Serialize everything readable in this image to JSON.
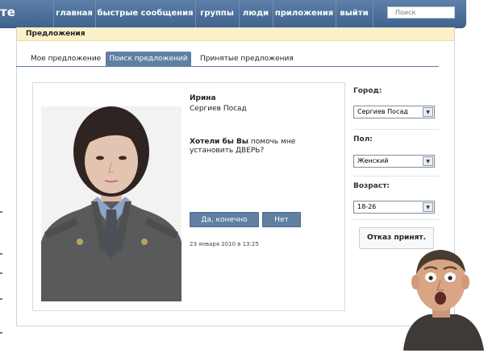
{
  "app": {
    "logo_text": "те"
  },
  "nav": {
    "items": [
      "главная",
      "быстрые сообщения",
      "группы",
      "люди",
      "приложения",
      "выйти"
    ],
    "search_placeholder": "Поиск"
  },
  "section": {
    "title": "Предложения"
  },
  "tabs": [
    {
      "label": "Мое предложение",
      "active": false
    },
    {
      "label": "Поиск предложений",
      "active": true
    },
    {
      "label": "Принятые предложения",
      "active": false
    }
  ],
  "card": {
    "name": "Ирина",
    "city": "Сергиев Посад",
    "question_bold": "Хотели бы Вы",
    "question_rest": " помочь мне установить ДВЕРЬ?",
    "accept_label": "Да, конечно",
    "decline_label": "Нет",
    "date": "23 января 2010 в 13:25"
  },
  "filters": {
    "city": {
      "label": "Город:",
      "value": "Сергиев Посад"
    },
    "gender": {
      "label": "Пол:",
      "value": "Женский"
    },
    "age": {
      "label": "Возраст:",
      "value": "18-26"
    }
  },
  "status": {
    "text": "Отказ принят."
  },
  "colors": {
    "nav_bg": "#4a6d96",
    "accent": "#5f7fa3",
    "section_head_bg": "#fcf0c8"
  }
}
